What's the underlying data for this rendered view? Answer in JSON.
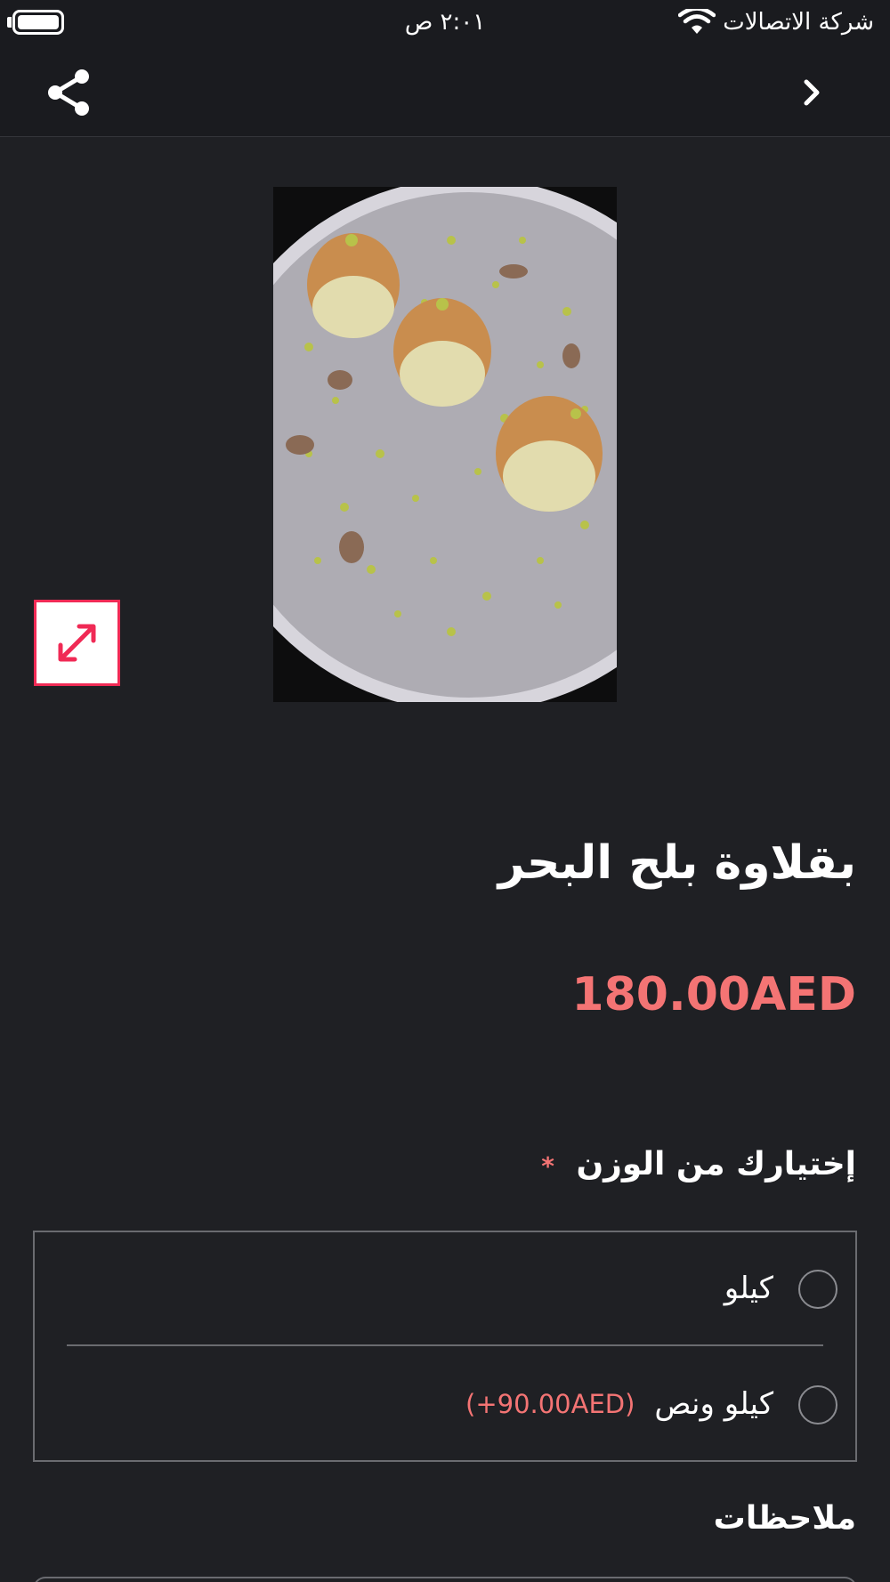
{
  "status_bar": {
    "time": "٢:٠١ ص",
    "carrier": "شركة الاتصالات"
  },
  "nav": {
    "share_icon": "share-icon",
    "back_icon": "chevron-right-icon"
  },
  "product": {
    "title": "بقلاوة بلح البحر",
    "price": "180.00AED",
    "image_alt": "baklava-dessert-photo"
  },
  "weight_section": {
    "label": "إختيارك من الوزن",
    "required_mark": "*",
    "options": [
      {
        "label": "كيلو",
        "extra": ""
      },
      {
        "label": "كيلو ونص",
        "extra": "(+90.00AED)"
      }
    ]
  },
  "notes": {
    "label": "ملاحظات"
  },
  "colors": {
    "background": "#1f2024",
    "accent": "#f47474",
    "expand_accent": "#f02a55"
  }
}
